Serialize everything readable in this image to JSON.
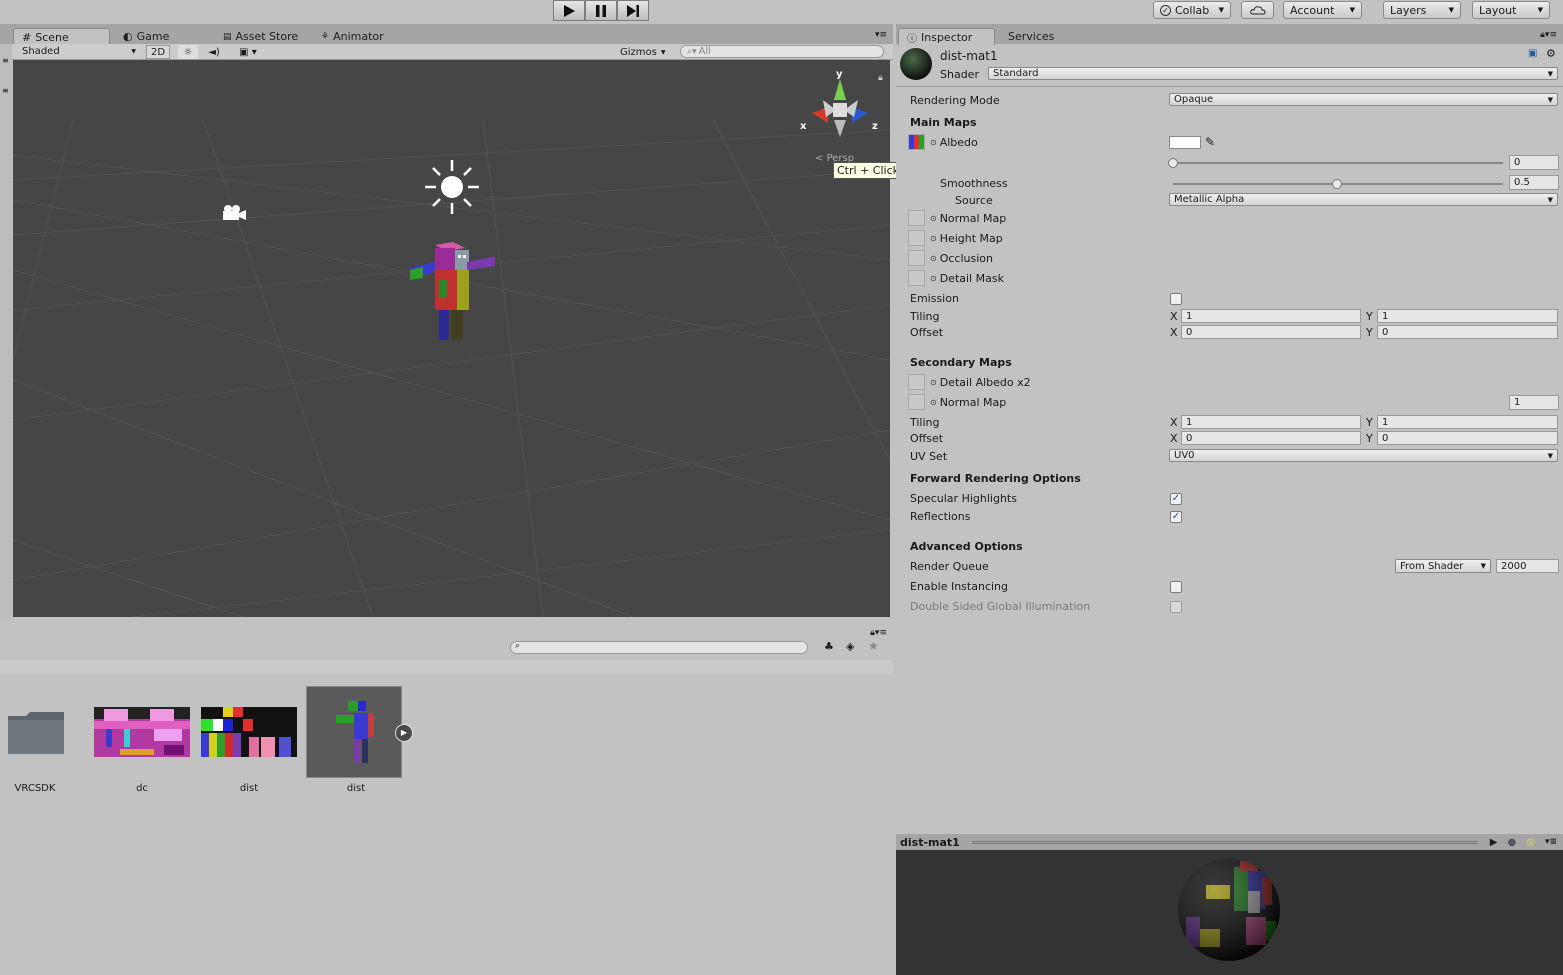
{
  "toolbar": {
    "collab": "Collab",
    "account": "Account",
    "layers": "Layers",
    "layout": "Layout"
  },
  "scene_panel": {
    "tabs": [
      "Scene",
      "Game",
      "Asset Store",
      "Animator"
    ],
    "shading_mode": "Shaded",
    "toggle_2d": "2D",
    "gizmos": "Gizmos",
    "search_placeholder": "All",
    "axis_x": "x",
    "axis_y": "y",
    "axis_z": "z",
    "persp_label": "Persp"
  },
  "project": {
    "assets": [
      {
        "label": "VRCSDK",
        "type": "folder"
      },
      {
        "label": "dc",
        "type": "texture"
      },
      {
        "label": "dist",
        "type": "texture"
      },
      {
        "label": "dist",
        "type": "model"
      }
    ]
  },
  "inspector": {
    "tabs": [
      "Inspector",
      "Services"
    ],
    "material_name": "dist-mat1",
    "shader_label": "Shader",
    "shader_value": "Standard",
    "rendering_mode_label": "Rendering Mode",
    "rendering_mode_value": "Opaque",
    "main_maps": "Main Maps",
    "albedo": "Albedo",
    "metallic_value": "0",
    "smoothness": "Smoothness",
    "smoothness_value": "0.5",
    "source": "Source",
    "source_value": "Metallic Alpha",
    "normal_map": "Normal Map",
    "height_map": "Height Map",
    "occlusion": "Occlusion",
    "detail_mask": "Detail Mask",
    "emission": "Emission",
    "tiling": "Tiling",
    "offset": "Offset",
    "tiling_x": "1",
    "tiling_y": "1",
    "offset_x": "0",
    "offset_y": "0",
    "secondary_maps": "Secondary Maps",
    "detail_albedo": "Detail Albedo x2",
    "secondary_normal_map": "Normal Map",
    "secondary_normal_value": "1",
    "sec_tiling_x": "1",
    "sec_tiling_y": "1",
    "sec_offset_x": "0",
    "sec_offset_y": "0",
    "uv_set": "UV Set",
    "uv_set_value": "UV0",
    "forward_rendering": "Forward Rendering Options",
    "specular_highlights": "Specular Highlights",
    "reflections": "Reflections",
    "advanced_options": "Advanced Options",
    "render_queue": "Render Queue",
    "render_queue_mode": "From Shader",
    "render_queue_value": "2000",
    "enable_instancing": "Enable Instancing",
    "double_sided_gi": "Double Sided Global Illumination",
    "x_label": "X",
    "y_label": "Y"
  },
  "tooltip": "Ctrl + Click to show preview",
  "preview": {
    "title": "dist-mat1"
  }
}
